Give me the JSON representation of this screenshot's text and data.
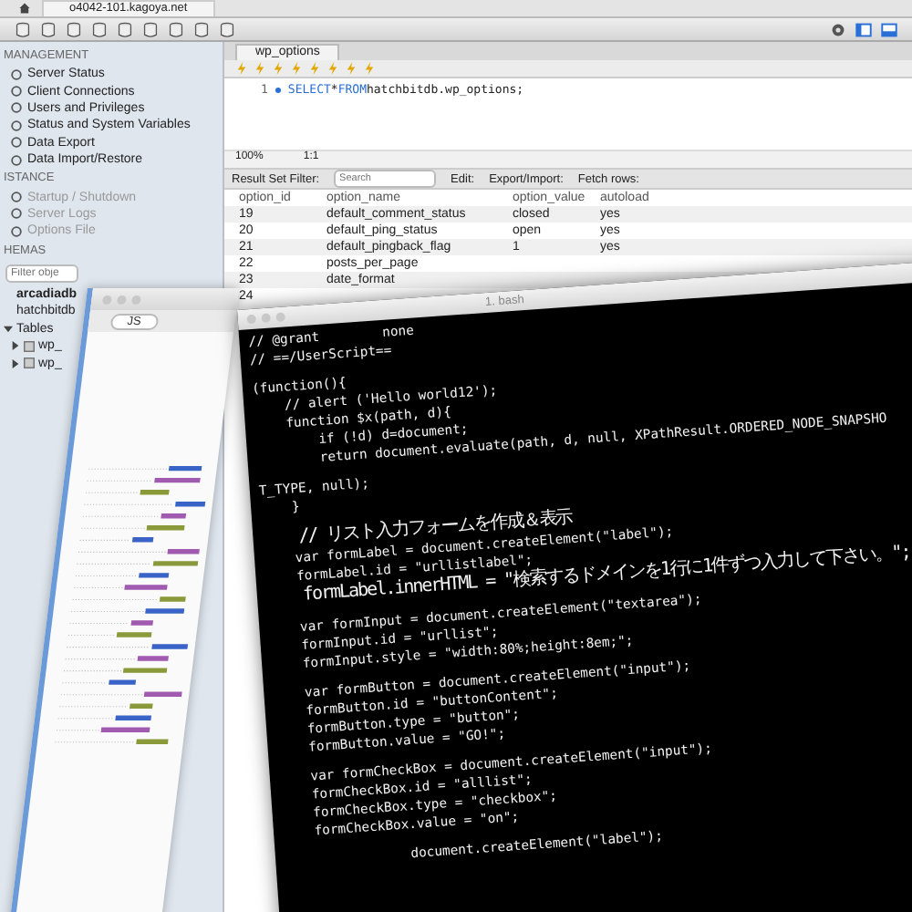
{
  "browser": {
    "tab_title": "o4042-101.kagoya.net"
  },
  "sidebar": {
    "sections": [
      {
        "title": "MANAGEMENT",
        "items": [
          {
            "label": "Server Status",
            "disabled": false
          },
          {
            "label": "Client Connections",
            "disabled": false
          },
          {
            "label": "Users and Privileges",
            "disabled": false
          },
          {
            "label": "Status and System Variables",
            "disabled": false
          },
          {
            "label": "Data Export",
            "disabled": false
          },
          {
            "label": "Data Import/Restore",
            "disabled": false
          }
        ]
      },
      {
        "title": "ISTANCE",
        "items": [
          {
            "label": "Startup / Shutdown",
            "disabled": true
          },
          {
            "label": "Server Logs",
            "disabled": true
          },
          {
            "label": "Options File",
            "disabled": true
          }
        ]
      }
    ],
    "schemas": {
      "title": "HEMAS",
      "filter_placeholder": "Filter obje",
      "tree": [
        {
          "label": "arcadiadb",
          "default": true,
          "expanded": false
        },
        {
          "label": "hatchbitdb",
          "default": false,
          "expanded": false
        },
        {
          "label": "Tables",
          "default": false,
          "expanded": true,
          "children": [
            {
              "label": "wp_"
            },
            {
              "label": "wp_"
            }
          ]
        }
      ]
    }
  },
  "query": {
    "tab": "wp_options",
    "line_number": "1",
    "sql": [
      {
        "text": "SELECT",
        "kind": "keyword"
      },
      {
        "text": "*",
        "kind": "plain"
      },
      {
        "text": "FROM",
        "kind": "keyword"
      },
      {
        "text": "hatchbitdb.wp_options;",
        "kind": "plain"
      }
    ],
    "zoom": "100%",
    "position": "1:1"
  },
  "results": {
    "filter_label": "Result Set Filter:",
    "search_placeholder": "Search",
    "edit_label": "Edit:",
    "export_label": "Export/Import:",
    "fetch_label": "Fetch rows:",
    "columns": [
      "option_id",
      "option_name",
      "option_value",
      "autoload"
    ],
    "rows": [
      [
        "19",
        "default_comment_status",
        "closed",
        "yes"
      ],
      [
        "20",
        "default_ping_status",
        "open",
        "yes"
      ],
      [
        "21",
        "default_pingback_flag",
        "1",
        "yes"
      ],
      [
        "22",
        "posts_per_page"
      ],
      [
        "23",
        "date_format"
      ],
      [
        "24"
      ]
    ]
  },
  "code_editor": {
    "search_value": "JS"
  },
  "terminal": {
    "tab": "1. bash",
    "lines": [
      {
        "text": "// @grant        none",
        "kind": "code",
        "space_before": false
      },
      {
        "text": "// ==/UserScript==",
        "kind": "code",
        "space_before": false
      },
      {
        "text": "(function(){",
        "kind": "code",
        "space_before": true
      },
      {
        "text": "    // alert ('Hello world12');",
        "kind": "code",
        "space_before": false
      },
      {
        "text": "    function $x(path, d){",
        "kind": "code",
        "space_before": false
      },
      {
        "text": "        if (!d) d=document;",
        "kind": "code",
        "space_before": false
      },
      {
        "text": "        return document.evaluate(path, d, null, XPathResult.ORDERED_NODE_SNAPSHO",
        "kind": "code",
        "space_before": false
      },
      {
        "text": "T_TYPE, null);",
        "kind": "code",
        "space_before": true
      },
      {
        "text": "    }",
        "kind": "code",
        "space_before": false
      },
      {
        "text": "    // リスト入力フォームを作成＆表示",
        "kind": "cjk",
        "space_before": true
      },
      {
        "text": "    var formLabel = document.createElement(\"label\");",
        "kind": "code",
        "space_before": false
      },
      {
        "text": "    formLabel.id = \"urllistlabel\";",
        "kind": "code",
        "space_before": false
      },
      {
        "text": "    formLabel.innerHTML = \"検索するドメインを1行に1件ずつ入力して下さい。\";",
        "kind": "cjk",
        "space_before": false
      },
      {
        "text": "    var formInput = document.createElement(\"textarea\");",
        "kind": "code",
        "space_before": true
      },
      {
        "text": "    formInput.id = \"urllist\";",
        "kind": "code",
        "space_before": false
      },
      {
        "text": "    formInput.style = \"width:80%;height:8em;\";",
        "kind": "code",
        "space_before": false
      },
      {
        "text": "    var formButton = document.createElement(\"input\");",
        "kind": "code",
        "space_before": true
      },
      {
        "text": "    formButton.id = \"buttonContent\";",
        "kind": "code",
        "space_before": false
      },
      {
        "text": "    formButton.type = \"button\";",
        "kind": "code",
        "space_before": false
      },
      {
        "text": "    formButton.value = \"GO!\";",
        "kind": "code",
        "space_before": false
      },
      {
        "text": "    var formCheckBox = document.createElement(\"input\");",
        "kind": "code",
        "space_before": true
      },
      {
        "text": "    formCheckBox.id = \"alllist\";",
        "kind": "code",
        "space_before": false
      },
      {
        "text": "    formCheckBox.type = \"checkbox\";",
        "kind": "code",
        "space_before": false
      },
      {
        "text": "    formCheckBox.value = \"on\";",
        "kind": "code",
        "space_before": false
      },
      {
        "text": "                document.createElement(\"label\");",
        "kind": "code",
        "space_before": true
      }
    ]
  }
}
